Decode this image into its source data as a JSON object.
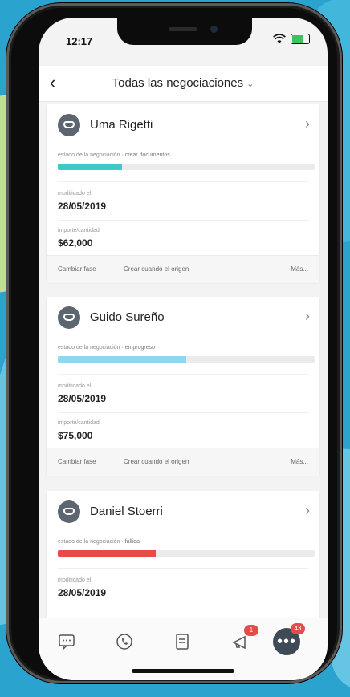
{
  "status_bar": {
    "time": "12:17"
  },
  "nav": {
    "back": "‹",
    "title": "Todas las negociaciones",
    "caret": "⌄"
  },
  "cards": [
    {
      "name": "Uma Rigetti",
      "stage_label": "estado de la negociación",
      "stage_value": "crear documentos",
      "progress": 0.25,
      "progress_color": "#3ec9c7",
      "date_label": "modificado el",
      "date": "28/05/2019",
      "amount_label": "importe/cantidad",
      "amount": "$62,000",
      "actions": [
        "Cambiar fase",
        "Crear cuando el origen",
        "Más..."
      ]
    },
    {
      "name": "Guido Sureño",
      "stage_label": "estado de la negociación",
      "stage_value": "en progreso",
      "progress": 0.5,
      "progress_color": "#8ed7ee",
      "date_label": "modificado el",
      "date": "28/05/2019",
      "amount_label": "importe/cantidad",
      "amount": "$75,000",
      "actions": [
        "Cambiar fase",
        "Crear cuando el origen",
        "Más..."
      ]
    },
    {
      "name": "Daniel Stoerri",
      "stage_label": "estado de la negociación",
      "stage_value": "fallida",
      "progress": 0.38,
      "progress_color": "#e54b4b",
      "date_label": "modificado el",
      "date": "28/05/2019"
    }
  ],
  "tabbar": {
    "items": [
      "chat-icon",
      "phone-icon",
      "tasks-icon",
      "notifications-icon",
      "more-icon"
    ],
    "notifications_badge": "1",
    "more_badge": "43",
    "more_glyph": "•••"
  }
}
